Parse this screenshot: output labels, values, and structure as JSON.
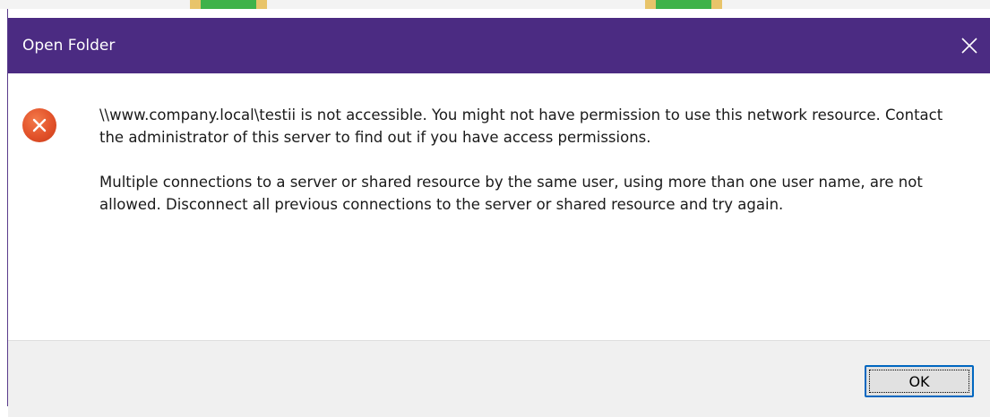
{
  "dialog": {
    "title": "Open Folder",
    "close_icon": "close-icon",
    "status_icon": "error-icon",
    "message_lines_1": "\\\\www.company.local\\testii is not accessible. You might not have permission to use this network resource. Contact the administrator of this server to find out if you have access permissions.",
    "message_lines_2": "Multiple connections to a server or shared resource by the same user, using more than one user name, are not allowed. Disconnect all previous connections to the server or shared resource and try again.",
    "ok_label": "OK"
  },
  "colors": {
    "titlebar": "#4b2b82",
    "error": "#e2522a",
    "button_border": "#0067c0",
    "footer": "#f0f0f0"
  }
}
